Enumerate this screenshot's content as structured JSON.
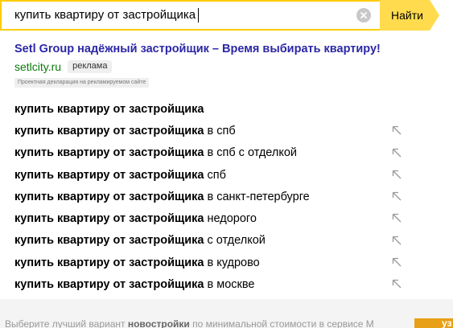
{
  "search": {
    "value": "купить квартиру от застройщика",
    "button_label": "Найти",
    "clear_icon": "clear-x-icon"
  },
  "ad": {
    "title": "Setl Group надёжный застройщик – Время выбирать квартиру!",
    "domain": "setlcity.ru",
    "badge": "реклама",
    "disclaimer": "Проектная декларация на рекламируемом сайте"
  },
  "suggestions": [
    {
      "bold": "купить квартиру от застройщика",
      "rest": "",
      "icon": false
    },
    {
      "bold": "купить квартиру от застройщика",
      "rest": "в спб",
      "icon": true
    },
    {
      "bold": "купить квартиру от застройщика",
      "rest": "в спб с отделкой",
      "icon": true
    },
    {
      "bold": "купить квартиру от застройщика",
      "rest": "спб",
      "icon": true
    },
    {
      "bold": "купить квартиру от застройщика",
      "rest": "в санкт-петербурге",
      "icon": true
    },
    {
      "bold": "купить квартиру от застройщика",
      "rest": "недорого",
      "icon": true
    },
    {
      "bold": "купить квартиру от застройщика",
      "rest": "с отделкой",
      "icon": true
    },
    {
      "bold": "купить квартиру от застройщика",
      "rest": "в кудрово",
      "icon": true
    },
    {
      "bold": "купить квартиру от застройщика",
      "rest": "в москве",
      "icon": true
    }
  ],
  "background_page": {
    "text_start": "Выберите лучший вариант ",
    "text_bold": "новостройки",
    "text_end": " по минимальной стоимости в сервисе М",
    "button_fragment": "уз"
  },
  "colors": {
    "accent": "#ffdb4d",
    "link": "#2c27a6",
    "domain": "#0a7a0a"
  }
}
